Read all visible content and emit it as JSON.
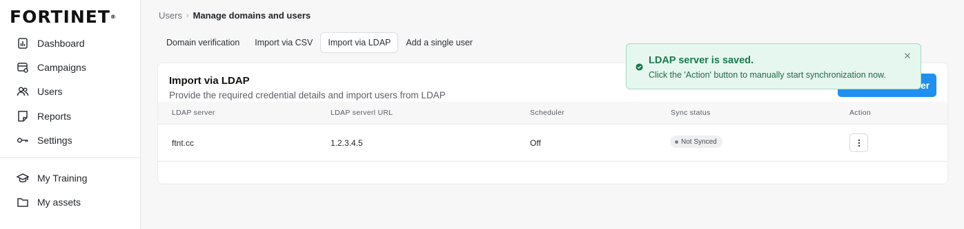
{
  "logo": {
    "text": "FORTINET",
    "mark": "®"
  },
  "sidebar": {
    "items": [
      {
        "label": "Dashboard",
        "icon": "dashboard-icon"
      },
      {
        "label": "Campaigns",
        "icon": "campaigns-icon"
      },
      {
        "label": "Users",
        "icon": "users-icon"
      },
      {
        "label": "Reports",
        "icon": "reports-icon"
      },
      {
        "label": "Settings",
        "icon": "key-icon"
      }
    ],
    "secondary": [
      {
        "label": "My Training",
        "icon": "graduation-cap-icon"
      },
      {
        "label": "My assets",
        "icon": "folder-icon"
      }
    ]
  },
  "breadcrumb": {
    "root": "Users",
    "current": "Manage domains and users"
  },
  "tabs": [
    {
      "label": "Domain verification"
    },
    {
      "label": "Import via CSV"
    },
    {
      "label": "Import via LDAP",
      "active": true
    },
    {
      "label": "Add a single user"
    }
  ],
  "card": {
    "title": "Import via LDAP",
    "subtitle": "Provide the required credential details and import users from LDAP",
    "primary_button_visible_text": "er"
  },
  "table": {
    "headers": [
      "LDAP server",
      "LDAP serverl URL",
      "Scheduler",
      "Sync status",
      "Action"
    ],
    "rows": [
      {
        "server": "ftnt.cc",
        "url": "1.2.3.4.5",
        "scheduler": "Off",
        "status": "Not Synced"
      }
    ]
  },
  "toast": {
    "title": "LDAP server is saved.",
    "message": "Click the 'Action' button to manually start synchronization now."
  },
  "colors": {
    "accent": "#1f8ff0",
    "toast_bg": "#e6f7ef",
    "toast_border": "#9fdcbf",
    "toast_text": "#1a7a4d"
  }
}
